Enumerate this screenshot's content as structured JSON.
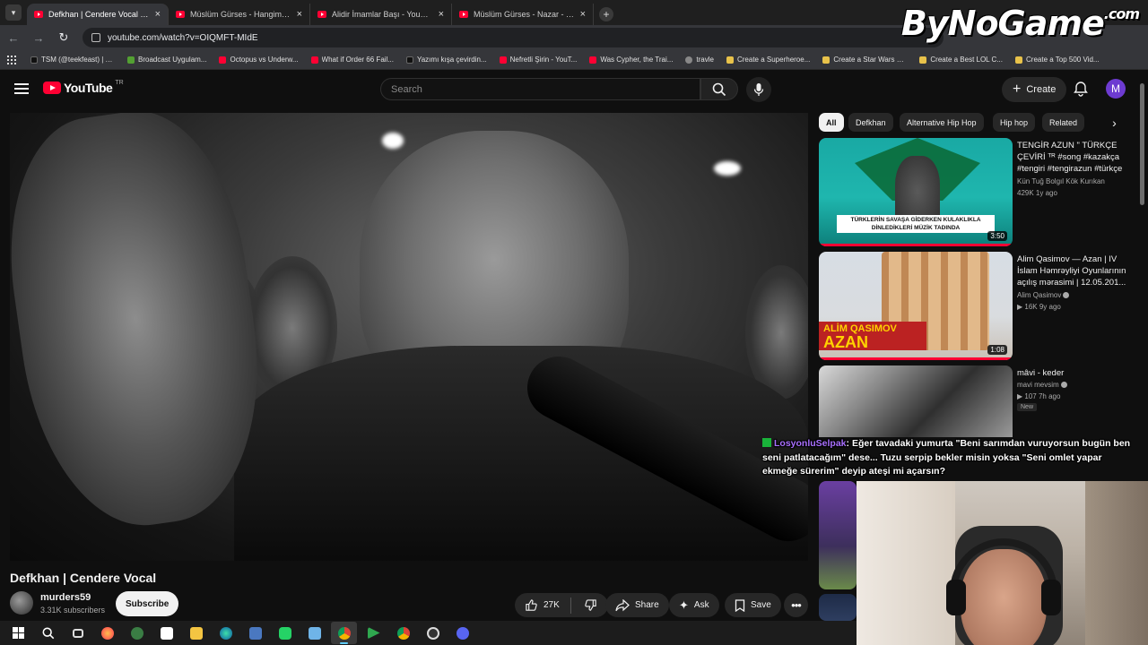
{
  "browser": {
    "tabs": [
      {
        "title": "Defkhan | Cendere Vocal - YouTube",
        "active": true
      },
      {
        "title": "Müslüm Gürses - Hangimiz Sevmedik",
        "active": false
      },
      {
        "title": "Alidir İmamlar Başı - YouTube",
        "active": false
      },
      {
        "title": "Müslüm Gürses - Nazar - YouTube",
        "active": false
      }
    ],
    "url": "youtube.com/watch?v=OIQMFT-MIdE",
    "bookmarks": [
      {
        "label": "TSM (@teekfeast) | T...",
        "color": "#000000"
      },
      {
        "label": "Broadcast Uygulam...",
        "color": "#53a032"
      },
      {
        "label": "Octopus vs Underw...",
        "color": "#ff0033"
      },
      {
        "label": "What if Order 66 Fail...",
        "color": "#ff0033"
      },
      {
        "label": "Yazımı kışa çevirdin...",
        "color": "#000000"
      },
      {
        "label": "Nefretli Şirin - YouT...",
        "color": "#ff0033"
      },
      {
        "label": "Was Cypher, the Trai...",
        "color": "#ff0033"
      },
      {
        "label": "travle",
        "color": "#888888"
      },
      {
        "label": "Create a Superheroe...",
        "color": "#e8c24a"
      },
      {
        "label": "Create a Star Wars C...",
        "color": "#e8c24a"
      },
      {
        "label": "Create a Best LOL C...",
        "color": "#e8c24a"
      },
      {
        "label": "Create a Top 500 Vid...",
        "color": "#e8c24a"
      }
    ]
  },
  "watermark": {
    "brand": "ByNoGame",
    "suffix": ".com"
  },
  "header": {
    "logo_text": "YouTube",
    "logo_region": "TR",
    "search_placeholder": "Search",
    "create_label": "Create",
    "avatar_letter": "M"
  },
  "video": {
    "title": "Defkhan | Cendere Vocal",
    "channel": "murders59",
    "subscribers": "3.31K subscribers",
    "subscribe_label": "Subscribe",
    "likes": "27K",
    "share_label": "Share",
    "ask_label": "Ask",
    "save_label": "Save"
  },
  "chips": [
    "All",
    "Defkhan",
    "Alternative Hip Hop",
    "Hip hop",
    "Related"
  ],
  "recommendations": [
    {
      "title": "TENGİR AZUN \" TÜRKÇE ÇEVİRİ ᵀᴿ #song #kazakça #tengiri #tengirazun #türkçe",
      "channel": "Kün Tuğ Bolgıl Kök Kurıkan",
      "meta": "429K  1y ago",
      "duration": "3:50",
      "thumb_caption": "TÜRKLERİN SAVAŞA GİDERKEN KULAKLIKLA DİNLEDİKLERİ MÜZİK TADINDA"
    },
    {
      "title": "Alim Qasimov — Azan | IV İslam Həmrəyliyi Oyunlarının açılış mərasimi | 12.05.201...",
      "channel": "Alim Qasimov",
      "meta": "16K  9y ago",
      "duration": "1:08",
      "thumb_caption_1": "ALİM QASIMOV",
      "thumb_caption_2": "AZAN"
    },
    {
      "title": "mâvi - keder",
      "channel": "mavi mevsim",
      "meta": "107  7h ago",
      "badge": "New"
    }
  ],
  "chat": {
    "user": "LosyonluSelpak",
    "message": ": Eğer tavadaki yumurta \"Beni sarımdan vuruyorsun bugün ben seni patlatacağım\" dese... Tuzu serpip bekler misin yoksa \"Seni omlet yapar ekmeğe sürerim\" deyip ateşi mi açarsın?"
  },
  "colors": {
    "background": "#0f0f0f",
    "youtube_red": "#ff0033",
    "chat_user": "#a970ff",
    "taskbar_accent": "#60cdff"
  }
}
